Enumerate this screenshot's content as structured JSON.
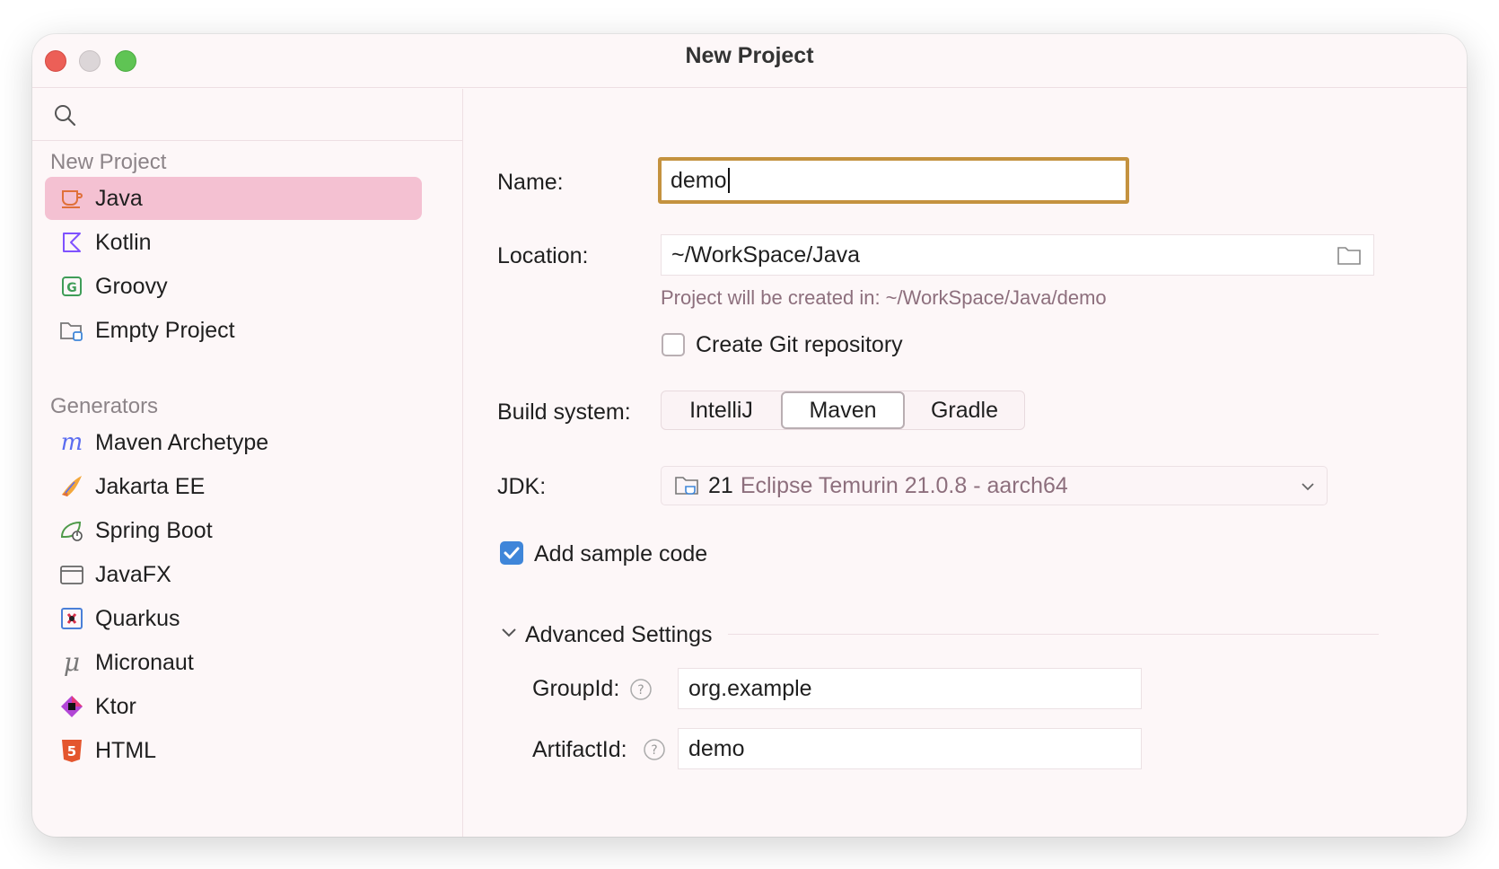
{
  "window": {
    "title": "New Project"
  },
  "sidebar": {
    "section_new_project": "New Project",
    "project_types": [
      {
        "label": "Java",
        "icon": "java-cup-icon",
        "selected": true
      },
      {
        "label": "Kotlin",
        "icon": "kotlin-icon"
      },
      {
        "label": "Groovy",
        "icon": "groovy-icon"
      },
      {
        "label": "Empty Project",
        "icon": "folder-icon"
      }
    ],
    "section_generators": "Generators",
    "generators": [
      {
        "label": "Maven Archetype",
        "icon": "maven-icon"
      },
      {
        "label": "Jakarta EE",
        "icon": "jakarta-icon"
      },
      {
        "label": "Spring Boot",
        "icon": "spring-boot-icon"
      },
      {
        "label": "JavaFX",
        "icon": "javafx-window-icon"
      },
      {
        "label": "Quarkus",
        "icon": "quarkus-icon"
      },
      {
        "label": "Micronaut",
        "icon": "micronaut-icon"
      },
      {
        "label": "Ktor",
        "icon": "ktor-icon"
      },
      {
        "label": "HTML",
        "icon": "html5-icon"
      }
    ]
  },
  "form": {
    "name_label": "Name:",
    "name_value": "demo",
    "location_label": "Location:",
    "location_value": "~/WorkSpace/Java",
    "location_hint": "Project will be created in: ~/WorkSpace/Java/demo",
    "git_checkbox_label": "Create Git repository",
    "git_checked": false,
    "build_system_label": "Build system:",
    "build_systems": [
      "IntelliJ",
      "Maven",
      "Gradle"
    ],
    "build_system_selected": "Maven",
    "jdk_label": "JDK:",
    "jdk_version": "21",
    "jdk_name": "Eclipse Temurin 21.0.8 - aarch64",
    "sample_code_label": "Add sample code",
    "sample_code_checked": true,
    "advanced_title": "Advanced Settings",
    "group_id_label": "GroupId:",
    "group_id_value": "org.example",
    "artifact_id_label": "ArtifactId:",
    "artifact_id_value": "demo"
  },
  "colors": {
    "accent_focus": "#c4923f",
    "selection": "#f4c1d2",
    "checkbox_checked": "#3f86d9"
  }
}
